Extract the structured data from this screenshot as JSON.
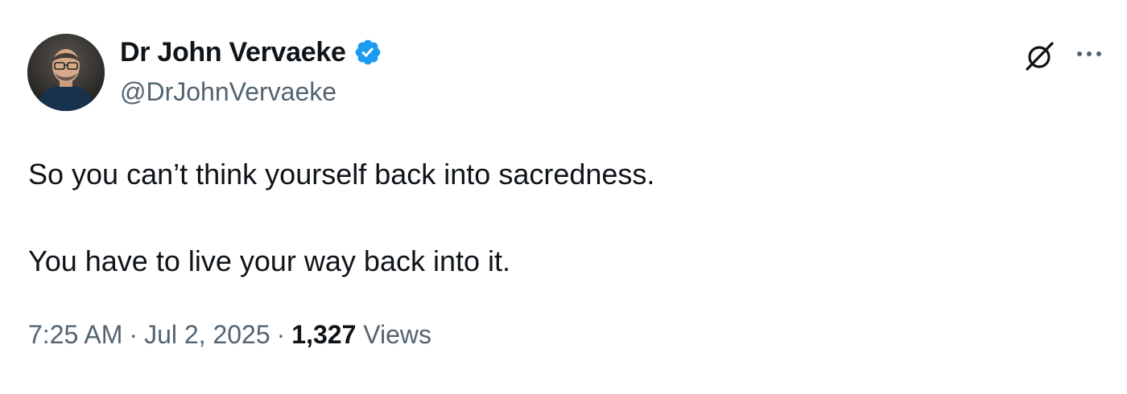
{
  "author": {
    "display_name": "Dr John Vervaeke",
    "handle": "@DrJohnVervaeke",
    "verified": true
  },
  "tweet": {
    "lines": [
      "So you can’t think yourself back into sacredness.",
      "You have to live your way back into it."
    ]
  },
  "meta": {
    "time": "7:25 AM",
    "date": "Jul 2, 2025",
    "separator": "·",
    "views_count": "1,327",
    "views_label": "Views"
  },
  "icons": {
    "verified": "verified-badge-icon",
    "grok": "grok-icon",
    "more": "more-options-icon"
  },
  "colors": {
    "verified_blue": "#1d9bf0",
    "text_primary": "#0f1419",
    "text_secondary": "#536471"
  }
}
